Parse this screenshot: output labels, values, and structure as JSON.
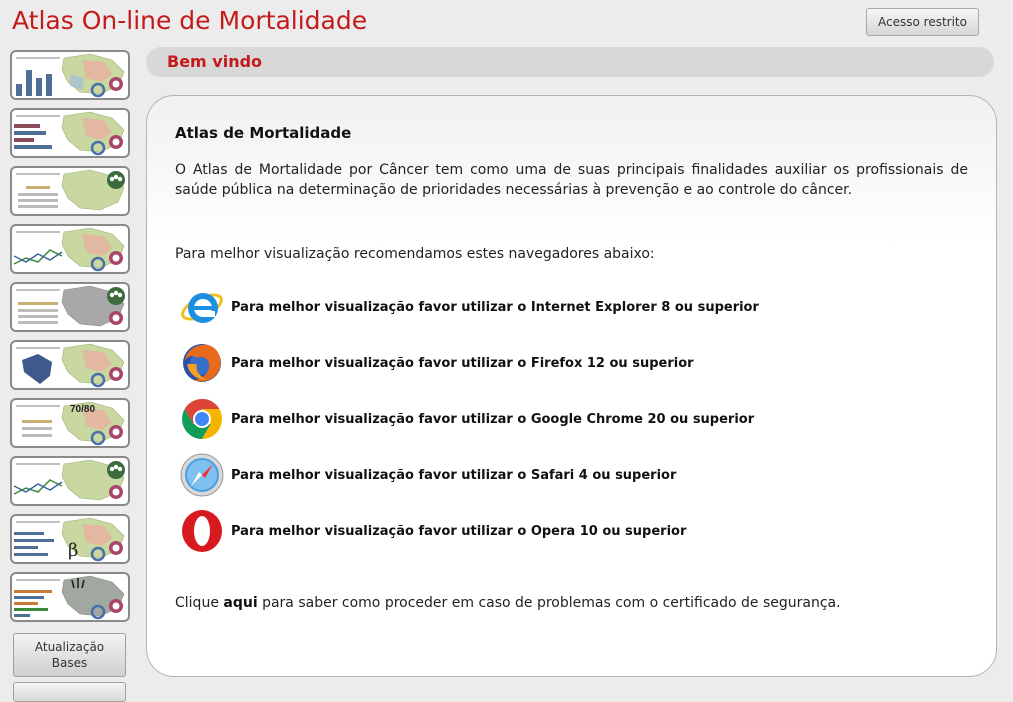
{
  "header": {
    "title": "Atlas On-line de Mortalidade",
    "restricted_label": "Acesso restrito"
  },
  "sidebar": {
    "items": [
      {
        "icon": "bar-chart-map-thumb"
      },
      {
        "icon": "horizontal-bar-map-thumb"
      },
      {
        "icon": "table-population-map-thumb"
      },
      {
        "icon": "line-chart-map-thumb"
      },
      {
        "icon": "table-population-grey-map-thumb"
      },
      {
        "icon": "brazil-map-thumb"
      },
      {
        "icon": "table-70-80-map-thumb",
        "badge": "70/80"
      },
      {
        "icon": "line-chart-population-map-thumb"
      },
      {
        "icon": "beta-bar-map-thumb",
        "symbol": "β"
      },
      {
        "icon": "age-bar-map-thumb"
      }
    ],
    "update_button": {
      "line1": "Atualização",
      "line2": "Bases"
    }
  },
  "welcome": {
    "title": "Bem vindo"
  },
  "content": {
    "title": "Atlas de Mortalidade",
    "intro": "O Atlas de Mortalidade por Câncer tem como uma de suas principais finalidades auxiliar os profissionais de saúde pública na determinação de prioridades necessárias à prevenção e ao controle do câncer.",
    "recommend": "Para melhor visualização recomendamos estes navegadores abaixo:",
    "browsers": [
      {
        "icon": "internet-explorer-icon",
        "text": "Para melhor visualização favor utilizar o Internet Explorer 8 ou superior"
      },
      {
        "icon": "firefox-icon",
        "text": "Para melhor visualização favor utilizar o Firefox 12 ou superior"
      },
      {
        "icon": "chrome-icon",
        "text": "Para melhor visualização favor utilizar o Google Chrome 20 ou superior"
      },
      {
        "icon": "safari-icon",
        "text": "Para melhor visualização favor utilizar o Safari 4 ou superior"
      },
      {
        "icon": "opera-icon",
        "text": "Para melhor visualização favor utilizar o Opera 10 ou superior"
      }
    ],
    "footer": {
      "before": "Clique ",
      "link": "aqui",
      "after": " para saber como proceder em caso de problemas com o certificado de segurança."
    }
  },
  "colors": {
    "accent": "#c41a1a",
    "background": "#ececec"
  }
}
